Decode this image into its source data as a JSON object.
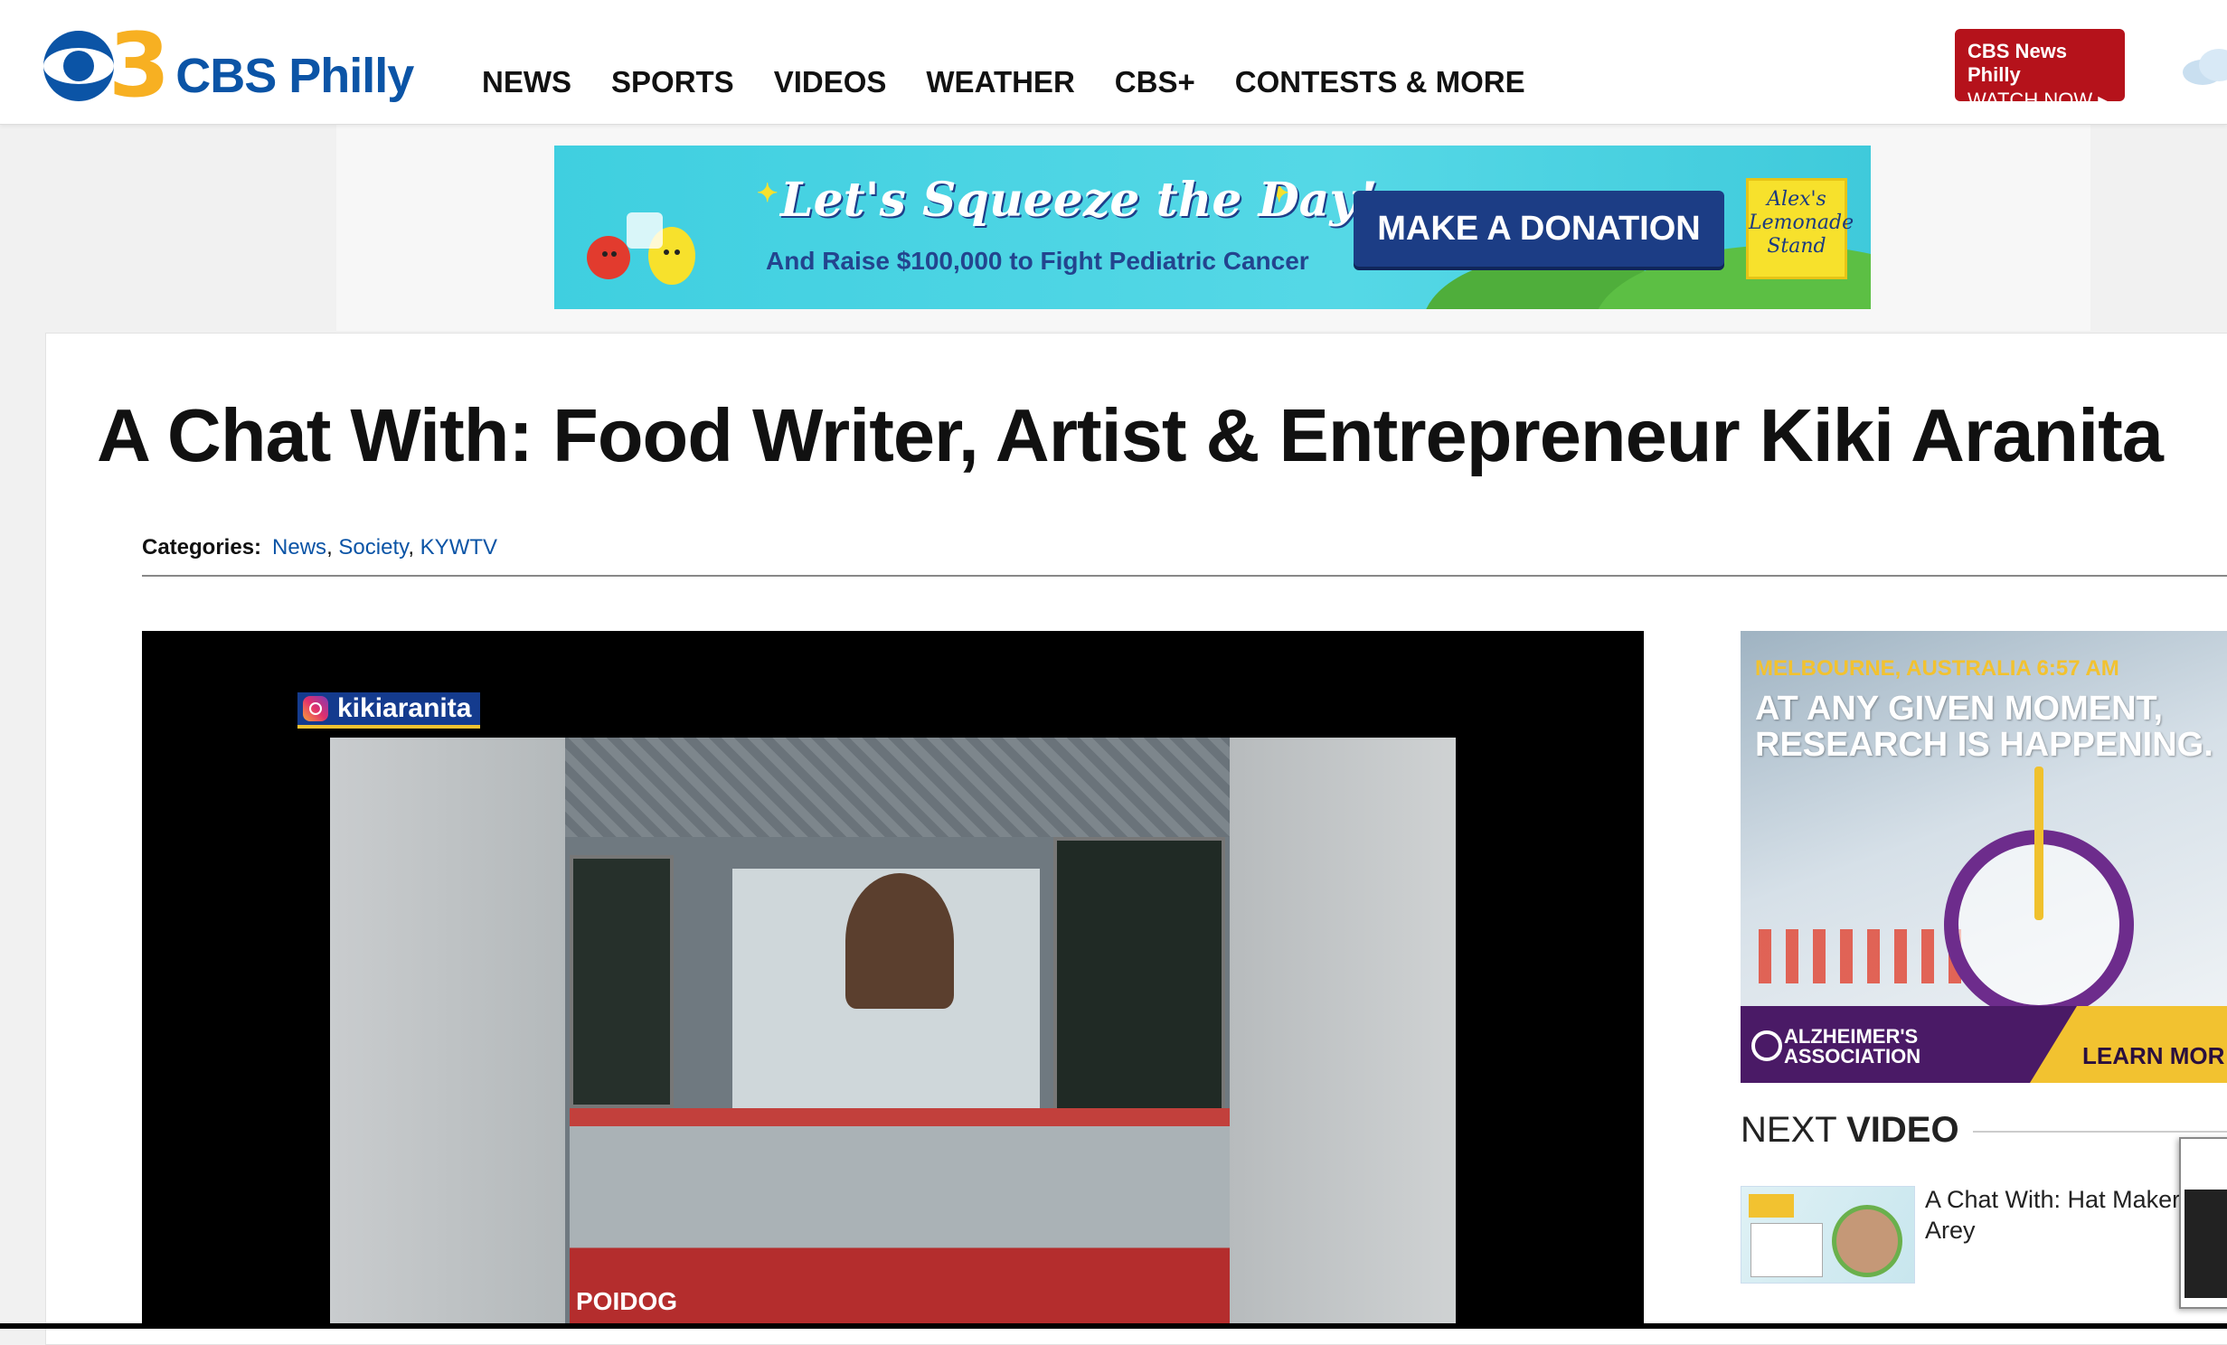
{
  "header": {
    "logo_number": "3",
    "logo_text": "CBS Philly",
    "nav": [
      "NEWS",
      "SPORTS",
      "VIDEOS",
      "WEATHER",
      "CBS+",
      "CONTESTS & MORE"
    ],
    "watch_line1": "CBS News Philly",
    "watch_line2": "WATCH NOW ▸"
  },
  "banner": {
    "headline": "Let's Squeeze the Day!",
    "sub": "And Raise $100,000 to Fight Pediatric Cancer",
    "cta": "MAKE A DONATION",
    "sponsor": "Alex's Lemonade Stand"
  },
  "article": {
    "title": "A Chat With: Food Writer, Artist & Entrepreneur Kiki Aranita",
    "categories_label": "Categories:",
    "categories": [
      "News",
      "Society",
      "KYWTV"
    ]
  },
  "video": {
    "instagram_handle": "kikiaranita",
    "truck_name": "POIDOG"
  },
  "side_ad": {
    "kicker": "MELBOURNE, AUSTRALIA 6:57 AM",
    "headline": "AT ANY GIVEN MOMENT, RESEARCH IS HAPPENING.",
    "org": "ALZHEIMER'S ASSOCIATION",
    "cta": "LEARN MOR"
  },
  "next_video": {
    "heading_light": "NEXT ",
    "heading_bold": "VIDEO",
    "item_title": "A Chat With: Hat Maker Arey"
  },
  "colors": {
    "brand_blue": "#0b54a6",
    "logo_gold": "#f7b022",
    "watch_red": "#b5121b",
    "link_blue": "#0b54a6"
  }
}
